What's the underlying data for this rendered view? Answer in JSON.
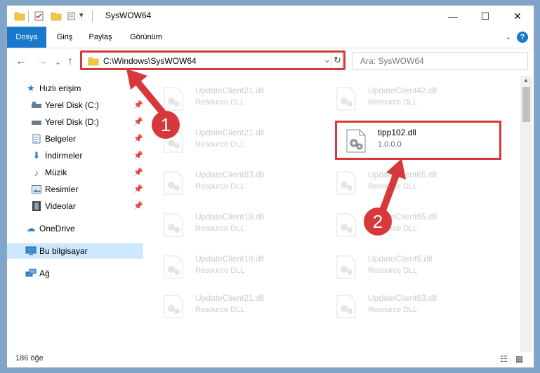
{
  "window": {
    "title": "SysWOW64",
    "minimize_glyph": "—",
    "maximize_glyph": "☐",
    "close_glyph": "✕"
  },
  "ribbon": {
    "tabs": [
      "Dosya",
      "Giriş",
      "Paylaş",
      "Görünüm"
    ],
    "help_glyph": "?",
    "collapse_glyph": "⌄"
  },
  "address": {
    "path": "C:\\Windows\\SysWOW64",
    "dropdown_glyph": "⌄",
    "refresh_glyph": "↻"
  },
  "search": {
    "placeholder": "Ara: SysWOW64"
  },
  "nav_glyphs": {
    "back": "←",
    "forward": "→",
    "recent": "⌄",
    "up": "↑"
  },
  "sidebar": {
    "items": [
      {
        "label": "Hızlı erişim",
        "icon": "star-icon",
        "pinned": false
      },
      {
        "label": "Yerel Disk (C:)",
        "icon": "drive-icon",
        "pinned": true
      },
      {
        "label": "Yerel Disk (D:)",
        "icon": "drive-icon",
        "pinned": true
      },
      {
        "label": "Belgeler",
        "icon": "documents-icon",
        "pinned": true
      },
      {
        "label": "İndirmeler",
        "icon": "download-icon",
        "pinned": true
      },
      {
        "label": "Müzik",
        "icon": "music-icon",
        "pinned": true
      },
      {
        "label": "Resimler",
        "icon": "pictures-icon",
        "pinned": true
      },
      {
        "label": "Videolar",
        "icon": "video-icon",
        "pinned": true
      },
      {
        "label": "OneDrive",
        "icon": "cloud-icon",
        "pinned": false
      },
      {
        "label": "Bu bilgisayar",
        "icon": "computer-icon",
        "pinned": false
      },
      {
        "label": "Ağ",
        "icon": "network-icon",
        "pinned": false
      }
    ]
  },
  "files": [
    {
      "name": "UpdateClient21.dll",
      "desc": "Resource DLL"
    },
    {
      "name": "UpdateClient42.dll",
      "desc": "Resource DLL"
    },
    {
      "name": "UpdateClient21.dll",
      "desc": "Resource DLL"
    },
    {
      "name": "tipp102.dll",
      "desc": "1.0.0.0"
    },
    {
      "name": "UpdateClient63.dll",
      "desc": "Resource DLL"
    },
    {
      "name": "UpdateClient65.dll",
      "desc": "Resource DLL"
    },
    {
      "name": "UpdateClient19.dll",
      "desc": "Resource DLL"
    },
    {
      "name": "UpdateClient65.dll",
      "desc": "Resource DLL"
    },
    {
      "name": "UpdateClient19.dll",
      "desc": "Resource DLL"
    },
    {
      "name": "UpdateClient5.dll",
      "desc": "Resource DLL"
    },
    {
      "name": "UpdateClient21.dll",
      "desc": "Resource DLL"
    },
    {
      "name": "UpdateClient63.dll",
      "desc": "Resource DLL"
    }
  ],
  "status": {
    "count": "186 öğe"
  },
  "callouts": {
    "one": "1",
    "two": "2"
  },
  "colors": {
    "accent": "#1979ca",
    "highlight": "#d7383b",
    "selection": "#cde8ff"
  }
}
